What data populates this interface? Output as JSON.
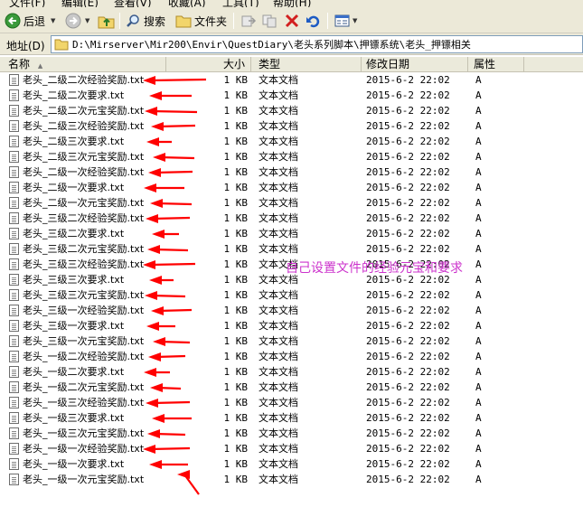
{
  "menubar": {
    "items": [
      "文件(F)",
      "编辑(E)",
      "查看(V)",
      "收藏(A)",
      "工具(T)",
      "帮助(H)"
    ]
  },
  "toolbar": {
    "back_label": "后退",
    "search_label": "搜索",
    "folders_label": "文件夹"
  },
  "address": {
    "label": "地址(D)",
    "path": "D:\\Mirserver\\Mir200\\Envir\\QuestDiary\\老头系列脚本\\押镖系统\\老头_押镖相关"
  },
  "columns": {
    "name": "名称",
    "size": "大小",
    "type": "类型",
    "modified": "修改日期",
    "attr": "属性"
  },
  "files": [
    {
      "name": "老头_二级二次经验奖励.txt",
      "size": "1 KB",
      "type": "文本文档",
      "modified": "2015-6-2 22:02",
      "attr": "A"
    },
    {
      "name": "老头_二级二次要求.txt",
      "size": "1 KB",
      "type": "文本文档",
      "modified": "2015-6-2 22:02",
      "attr": "A"
    },
    {
      "name": "老头_二级二次元宝奖励.txt",
      "size": "1 KB",
      "type": "文本文档",
      "modified": "2015-6-2 22:02",
      "attr": "A"
    },
    {
      "name": "老头_二级三次经验奖励.txt",
      "size": "1 KB",
      "type": "文本文档",
      "modified": "2015-6-2 22:02",
      "attr": "A"
    },
    {
      "name": "老头_二级三次要求.txt",
      "size": "1 KB",
      "type": "文本文档",
      "modified": "2015-6-2 22:02",
      "attr": "A"
    },
    {
      "name": "老头_二级三次元宝奖励.txt",
      "size": "1 KB",
      "type": "文本文档",
      "modified": "2015-6-2 22:02",
      "attr": "A"
    },
    {
      "name": "老头_二级一次经验奖励.txt",
      "size": "1 KB",
      "type": "文本文档",
      "modified": "2015-6-2 22:02",
      "attr": "A"
    },
    {
      "name": "老头_二级一次要求.txt",
      "size": "1 KB",
      "type": "文本文档",
      "modified": "2015-6-2 22:02",
      "attr": "A"
    },
    {
      "name": "老头_二级一次元宝奖励.txt",
      "size": "1 KB",
      "type": "文本文档",
      "modified": "2015-6-2 22:02",
      "attr": "A"
    },
    {
      "name": "老头_三级二次经验奖励.txt",
      "size": "1 KB",
      "type": "文本文档",
      "modified": "2015-6-2 22:02",
      "attr": "A"
    },
    {
      "name": "老头_三级二次要求.txt",
      "size": "1 KB",
      "type": "文本文档",
      "modified": "2015-6-2 22:02",
      "attr": "A"
    },
    {
      "name": "老头_三级二次元宝奖励.txt",
      "size": "1 KB",
      "type": "文本文档",
      "modified": "2015-6-2 22:02",
      "attr": "A"
    },
    {
      "name": "老头_三级三次经验奖励.txt",
      "size": "1 KB",
      "type": "文本文档",
      "modified": "2015-6-2 22:02",
      "attr": "A"
    },
    {
      "name": "老头_三级三次要求.txt",
      "size": "1 KB",
      "type": "文本文档",
      "modified": "2015-6-2 22:02",
      "attr": "A"
    },
    {
      "name": "老头_三级三次元宝奖励.txt",
      "size": "1 KB",
      "type": "文本文档",
      "modified": "2015-6-2 22:02",
      "attr": "A"
    },
    {
      "name": "老头_三级一次经验奖励.txt",
      "size": "1 KB",
      "type": "文本文档",
      "modified": "2015-6-2 22:02",
      "attr": "A"
    },
    {
      "name": "老头_三级一次要求.txt",
      "size": "1 KB",
      "type": "文本文档",
      "modified": "2015-6-2 22:02",
      "attr": "A"
    },
    {
      "name": "老头_三级一次元宝奖励.txt",
      "size": "1 KB",
      "type": "文本文档",
      "modified": "2015-6-2 22:02",
      "attr": "A"
    },
    {
      "name": "老头_一级二次经验奖励.txt",
      "size": "1 KB",
      "type": "文本文档",
      "modified": "2015-6-2 22:02",
      "attr": "A"
    },
    {
      "name": "老头_一级二次要求.txt",
      "size": "1 KB",
      "type": "文本文档",
      "modified": "2015-6-2 22:02",
      "attr": "A"
    },
    {
      "name": "老头_一级二次元宝奖励.txt",
      "size": "1 KB",
      "type": "文本文档",
      "modified": "2015-6-2 22:02",
      "attr": "A"
    },
    {
      "name": "老头_一级三次经验奖励.txt",
      "size": "1 KB",
      "type": "文本文档",
      "modified": "2015-6-2 22:02",
      "attr": "A"
    },
    {
      "name": "老头_一级三次要求.txt",
      "size": "1 KB",
      "type": "文本文档",
      "modified": "2015-6-2 22:02",
      "attr": "A"
    },
    {
      "name": "老头_一级三次元宝奖励.txt",
      "size": "1 KB",
      "type": "文本文档",
      "modified": "2015-6-2 22:02",
      "attr": "A"
    },
    {
      "name": "老头_一级一次经验奖励.txt",
      "size": "1 KB",
      "type": "文本文档",
      "modified": "2015-6-2 22:02",
      "attr": "A"
    },
    {
      "name": "老头_一级一次要求.txt",
      "size": "1 KB",
      "type": "文本文档",
      "modified": "2015-6-2 22:02",
      "attr": "A"
    },
    {
      "name": "老头_一级一次元宝奖励.txt",
      "size": "1 KB",
      "type": "文本文档",
      "modified": "2015-6-2 22:02",
      "attr": "A"
    }
  ],
  "annotation": {
    "text": "自己设置文件的经验元宝和要求",
    "color": "#cc33cc"
  },
  "colors": {
    "arrow": "#ff0000",
    "chrome": "#ece9d8"
  }
}
